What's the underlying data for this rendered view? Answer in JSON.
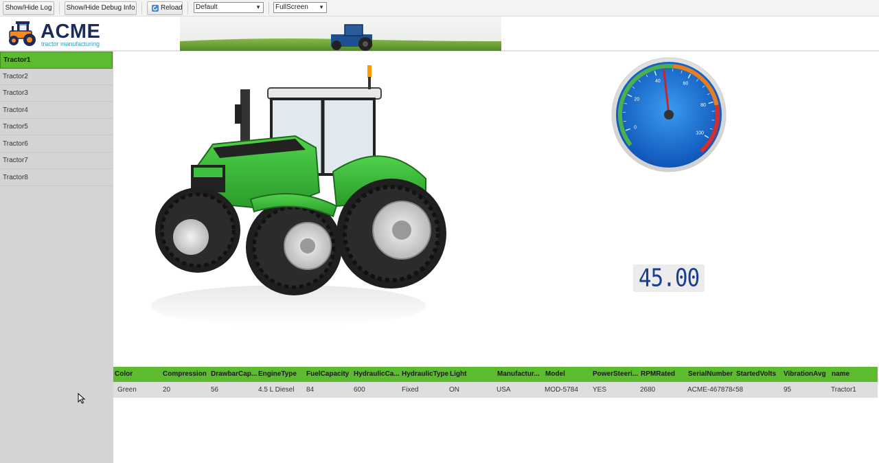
{
  "toolbar": {
    "show_hide_log": "Show/Hide Log",
    "show_hide_debug": "Show/Hide Debug Info",
    "reload": "Reload",
    "reload_icon": "reload-icon",
    "theme_select": {
      "value": "Default"
    },
    "display_select": {
      "value": "FullScreen"
    }
  },
  "header": {
    "logo_title": "ACME",
    "logo_subtitle": "tractor manufacturing",
    "logo_icon": "tractor-logo-icon"
  },
  "sidebar": {
    "items": [
      {
        "label": "Tractor1",
        "active": true
      },
      {
        "label": "Tractor2"
      },
      {
        "label": "Tractor3"
      },
      {
        "label": "Tractor4"
      },
      {
        "label": "Tractor5"
      },
      {
        "label": "Tractor6"
      },
      {
        "label": "Tractor7"
      },
      {
        "label": "Tractor8"
      }
    ]
  },
  "gauge": {
    "ticks": [
      "0",
      "20",
      "40",
      "60",
      "80",
      "100"
    ],
    "value": 45,
    "colors": {
      "face": "#1a6fd0",
      "green_band": "#4caf50",
      "orange_band": "#e67e22",
      "red_band": "#d32f2f",
      "needle": "#c62828"
    }
  },
  "digital_display": {
    "value": "45.00"
  },
  "table": {
    "headers": [
      "Color",
      "Compression",
      "DrawbarCap...",
      "EngineType",
      "FuelCapacity",
      "HydraulicCa...",
      "HydraulicType",
      "Light",
      "Manufactur...",
      "Model",
      "PowerSteeri...",
      "RPMRated",
      "SerialNumber",
      "StartedVolts",
      "VibrationAvg",
      "name"
    ],
    "row": [
      "Green",
      "20",
      "56",
      "4.5 L Diesel",
      "84",
      "600",
      "Fixed",
      "ON",
      "USA",
      "MOD-5784",
      "YES",
      "2680",
      "ACME-4678784",
      "58",
      "95",
      "Tractor1"
    ]
  },
  "colors": {
    "accent_green": "#5dbb2f",
    "brand_navy": "#1c2b5a",
    "brand_teal": "#2aa0c6"
  }
}
